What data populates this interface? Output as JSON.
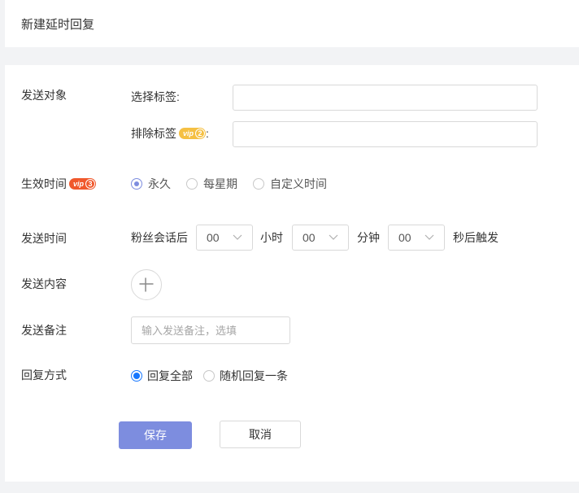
{
  "page": {
    "title": "新建延时回复"
  },
  "target": {
    "label": "发送对象",
    "select_tags_label": "选择标签:",
    "exclude_tags_label": "排除标签",
    "exclude_tags_colon": ":",
    "exclude_badge": {
      "text": "vip",
      "level": "2",
      "color": "#f5c043"
    }
  },
  "effective_time": {
    "label": "生效时间",
    "badge": {
      "text": "vip",
      "level": "3",
      "color": "#f0582c"
    },
    "options": [
      "永久",
      "每星期",
      "自定义时间"
    ],
    "selected": "永久"
  },
  "send_time": {
    "label": "发送时间",
    "prefix": "粉丝会话后",
    "hours": "00",
    "hours_unit": "小时",
    "minutes": "00",
    "minutes_unit": "分钟",
    "seconds": "00",
    "seconds_unit": "秒后触发"
  },
  "content": {
    "label": "发送内容"
  },
  "note": {
    "label": "发送备注",
    "placeholder": "输入发送备注，选填",
    "value": ""
  },
  "reply_mode": {
    "label": "回复方式",
    "options": [
      "回复全部",
      "随机回复一条"
    ],
    "selected": "回复全部"
  },
  "actions": {
    "save": "保存",
    "cancel": "取消"
  },
  "colors": {
    "primary": "#7d8ddf",
    "radio_blue": "#1677ff",
    "border": "#d9d9d9"
  }
}
